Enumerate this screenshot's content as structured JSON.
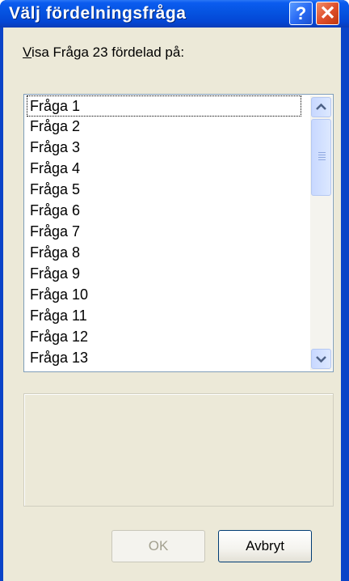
{
  "window": {
    "title": "Välj fördelningsfråga",
    "help_glyph": "?",
    "close_glyph": "✕"
  },
  "dialog": {
    "label_prefix": "V",
    "label_rest": "isa Fråga 23 fördelad på:",
    "list_items": [
      "Fråga 1",
      "Fråga 2",
      "Fråga 3",
      "Fråga 4",
      "Fråga 5",
      "Fråga 6",
      "Fråga 7",
      "Fråga 8",
      "Fråga 9",
      "Fråga 10",
      "Fråga 11",
      "Fråga 12",
      "Fråga 13"
    ],
    "focused_index": 0,
    "ok_label": "OK",
    "cancel_label": "Avbryt"
  }
}
